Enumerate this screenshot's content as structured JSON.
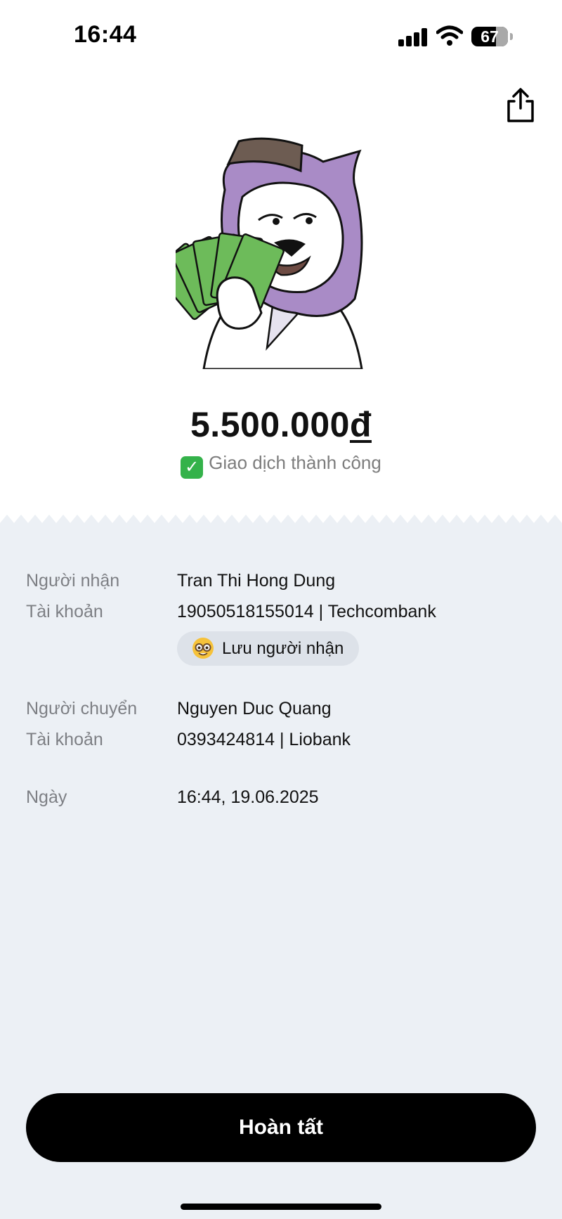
{
  "status_bar": {
    "time": "16:44",
    "battery_level": "67",
    "icons": [
      "signal-icon",
      "wifi-icon",
      "battery-icon"
    ]
  },
  "header": {
    "share_icon": "share-icon"
  },
  "transaction": {
    "amount": "5.500.000",
    "currency": "đ",
    "status_icon": "check-icon",
    "status": "Giao dịch thành công"
  },
  "details": {
    "recipient_label": "Người nhận",
    "recipient_name": "Tran Thi Hong Dung",
    "recipient_account_label": "Tài khoản",
    "recipient_account": "19050518155014 | Techcombank",
    "save_recipient": "Lưu người nhận",
    "sender_label": "Người chuyển",
    "sender_name": "Nguyen Duc Quang",
    "sender_account_label": "Tài khoản",
    "sender_account": "0393424814 | Liobank",
    "date_label": "Ngày",
    "date": "16:44, 19.06.2025"
  },
  "footer": {
    "done_label": "Hoàn tất"
  },
  "colors": {
    "receipt_bg": "#ecf0f5",
    "chip_bg": "#dde2e9",
    "label_text": "#7d7f84",
    "button_bg": "#000000",
    "success_green": "#34b24a",
    "mascot_purple": "#a98bc6",
    "money_green": "#6dbb5a"
  }
}
